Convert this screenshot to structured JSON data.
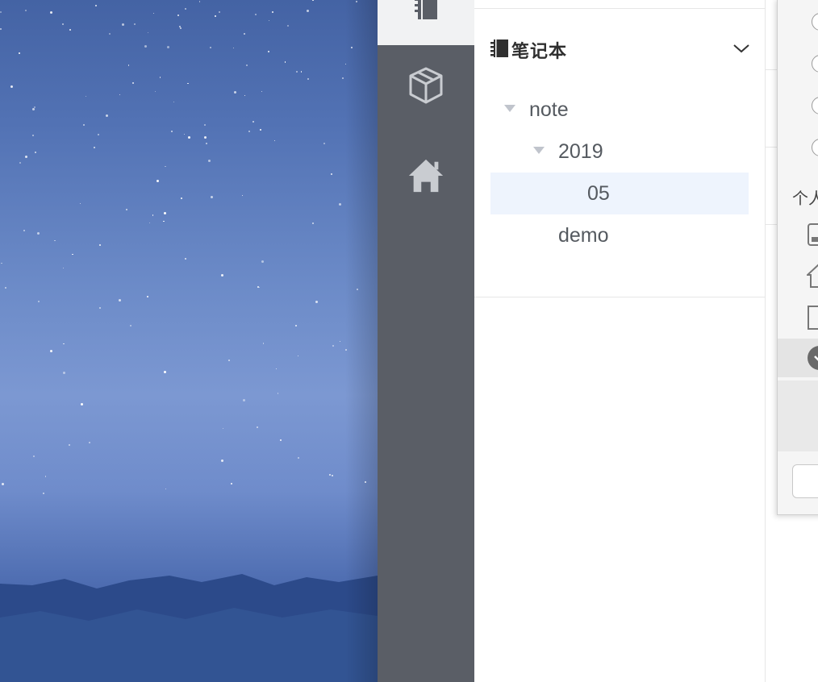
{
  "notebook_panel": {
    "title": "笔记本",
    "tree": [
      {
        "label": "note",
        "level": 0,
        "expanded": true
      },
      {
        "label": "2019",
        "level": 1,
        "expanded": true
      },
      {
        "label": "05",
        "level": 2,
        "selected": true
      },
      {
        "label": "demo",
        "level": 1
      }
    ]
  },
  "rail": {
    "items": [
      {
        "icon": "notebook-icon",
        "active": true
      },
      {
        "icon": "cube-icon"
      },
      {
        "icon": "home-icon"
      }
    ]
  },
  "dialog": {
    "section_label": "个人"
  },
  "colors": {
    "rail_bg": "#5a5e66",
    "selected_row_bg": "#eef4fd",
    "wallpaper_blue": "#5a78bc"
  }
}
